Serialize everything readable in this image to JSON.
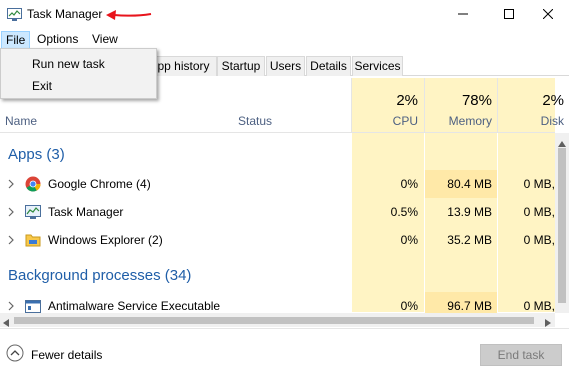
{
  "window": {
    "title": "Task Manager",
    "app_icon": "task-manager-icon",
    "minimize_icon": "minimize-icon",
    "maximize_icon": "maximize-icon",
    "close_icon": "close-icon"
  },
  "menubar": {
    "file": "File",
    "options": "Options",
    "view": "View"
  },
  "file_menu": {
    "items": [
      "Run new task",
      "Exit"
    ],
    "highlighted": "Run new task",
    "arrow_color": "#e8141c"
  },
  "tabs": [
    "pp history",
    "Startup",
    "Users",
    "Details",
    "Services"
  ],
  "columns": {
    "name": "Name",
    "status": "Status",
    "cpu": {
      "percent": "2%",
      "label": "CPU"
    },
    "memory": {
      "percent": "78%",
      "label": "Memory"
    },
    "disk": {
      "percent": "2%",
      "label": "Disk"
    }
  },
  "groups": {
    "apps": "Apps (3)",
    "background": "Background processes (34)"
  },
  "rows": [
    {
      "name": "Google Chrome (4)",
      "icon": "chrome-icon",
      "cpu": "0%",
      "memory": "80.4 MB",
      "disk": "0 MB,"
    },
    {
      "name": "Task Manager",
      "icon": "task-manager-icon",
      "cpu": "0.5%",
      "memory": "13.9 MB",
      "disk": "0 MB,"
    },
    {
      "name": "Windows Explorer (2)",
      "icon": "folder-icon",
      "cpu": "0%",
      "memory": "35.2 MB",
      "disk": "0 MB,"
    },
    {
      "name": "Antimalware Service Executable",
      "icon": "service-icon",
      "cpu": "0%",
      "memory": "96.7 MB",
      "disk": "0 MB,"
    }
  ],
  "footer": {
    "fewer_details": "Fewer details",
    "end_task": "End task"
  },
  "colors": {
    "accent": "#1f5ea8",
    "column_highlight": "#fff4c4",
    "memory_highlight": "#ffe9a8",
    "menu_selected": "#cce8ff"
  }
}
